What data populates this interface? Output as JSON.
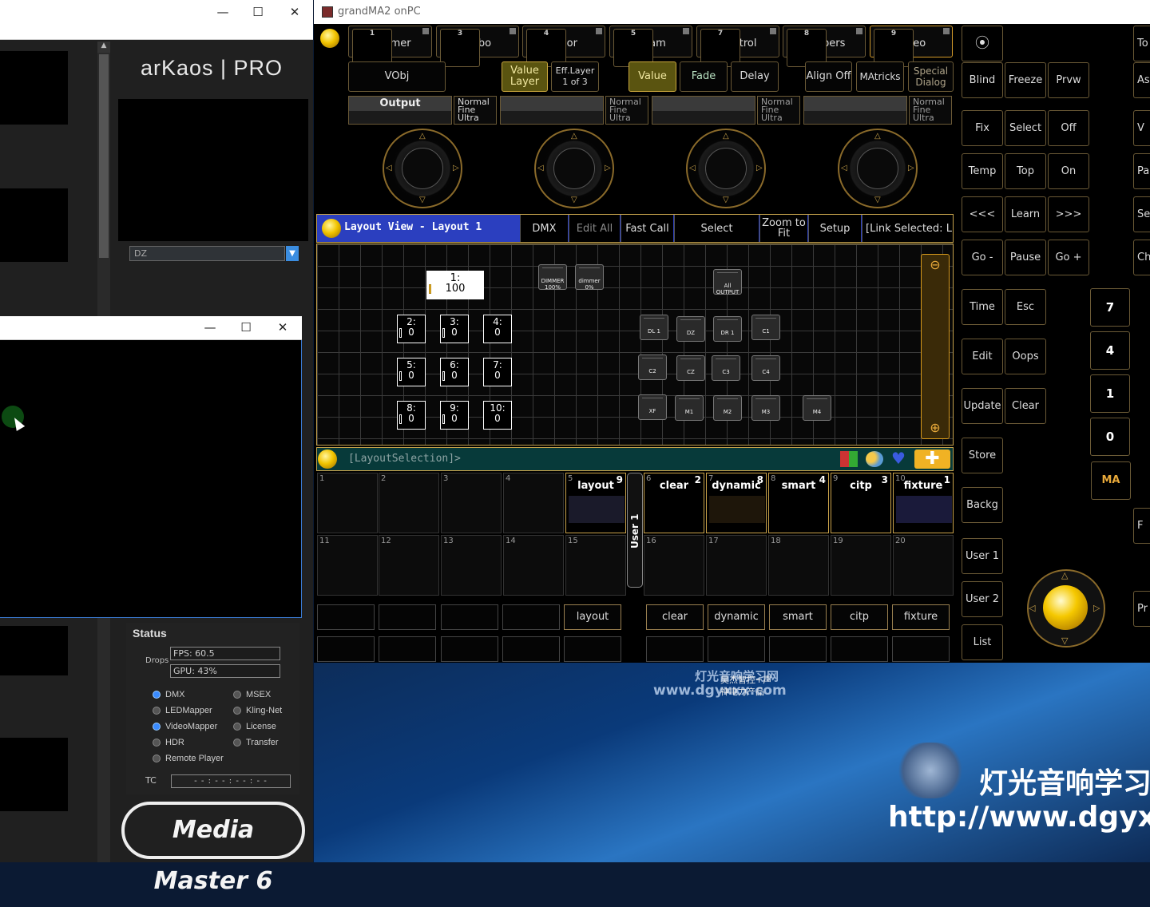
{
  "mediamaster": {
    "logo": "arKaos | PRO",
    "preview_select_value": "DZ",
    "status": {
      "heading": "Status",
      "drops_label": "Drops",
      "fps": "FPS: 60.5",
      "gpu": "GPU: 43%",
      "radios": [
        {
          "label": "DMX",
          "on": true
        },
        {
          "label": "MSEX",
          "on": false
        },
        {
          "label": "LEDMapper",
          "on": false
        },
        {
          "label": "Kling-Net",
          "on": false
        },
        {
          "label": "VideoMapper",
          "on": true
        },
        {
          "label": "License",
          "on": false
        },
        {
          "label": "HDR",
          "on": false
        },
        {
          "label": "Transfer",
          "on": false
        },
        {
          "label": "Remote Player",
          "on": false
        }
      ],
      "tc_label": "TC",
      "tc_value": "- - : - - : - - : - -"
    },
    "brand": "Media Master 6",
    "window_controls": [
      "—",
      "☐",
      "✕"
    ]
  },
  "grandma": {
    "title": "grandMA2 onPC",
    "attributes": [
      {
        "num": "1",
        "label": "Dimmer"
      },
      {
        "num": "3",
        "label": "Gobo"
      },
      {
        "num": "4",
        "label": "Color"
      },
      {
        "num": "5",
        "label": "Beam"
      },
      {
        "num": "7",
        "label": "Control"
      },
      {
        "num": "8",
        "label": "Shapers"
      },
      {
        "num": "9",
        "label": "Video"
      }
    ],
    "encoder_buttons": {
      "vobj": "VObj",
      "value_layer": "Value Layer",
      "eff_layer": "Eff.Layer 1 of 3",
      "value": "Value",
      "fade": "Fade",
      "delay": "Delay",
      "align_off": "Align Off",
      "matricks": "MAtricks",
      "special_dialog": "Special Dialog"
    },
    "encoder_output": "Output",
    "resolution": "Normal Fine Ultra",
    "layout_view": {
      "title": "Layout View - Layout 1",
      "tabs": [
        "DMX",
        "Edit All",
        "Fast Call",
        "Select",
        "Zoom to Fit",
        "Setup",
        "[Link Selected: L"
      ],
      "cells": [
        {
          "id": "1:",
          "val": "100"
        },
        {
          "id": "2:",
          "val": "0"
        },
        {
          "id": "3:",
          "val": "0"
        },
        {
          "id": "4:",
          "val": "0"
        },
        {
          "id": "5:",
          "val": "0"
        },
        {
          "id": "6:",
          "val": "0"
        },
        {
          "id": "7:",
          "val": "0"
        },
        {
          "id": "8:",
          "val": "0"
        },
        {
          "id": "9:",
          "val": "0"
        },
        {
          "id": "10:",
          "val": "0"
        }
      ],
      "fixtures": [
        "DIMMER 100%",
        "dimmer 0%",
        "All OUTPUT",
        "DL 1",
        "DZ",
        "DR 1",
        "C1",
        "C2",
        "CZ",
        "C3",
        "C4",
        "XF",
        "M1",
        "M2",
        "M3",
        "M4"
      ]
    },
    "selection_bar": "[LayoutSelection]>",
    "pool": {
      "side_label": "User 1",
      "row1": [
        {
          "n": "1"
        },
        {
          "n": "2"
        },
        {
          "n": "3"
        },
        {
          "n": "4"
        },
        {
          "n": "5",
          "label": "layout",
          "count": "9"
        },
        {
          "n": "6",
          "label": "clear",
          "count": "2"
        },
        {
          "n": "7",
          "label": "dynamic",
          "count": "8"
        },
        {
          "n": "8",
          "label": "smart",
          "count": "4"
        },
        {
          "n": "9",
          "label": "citp",
          "count": "3"
        },
        {
          "n": "10",
          "label": "fixture",
          "count": "1"
        }
      ],
      "row2": [
        "11",
        "12",
        "13",
        "14",
        "15",
        "16",
        "17",
        "18",
        "19",
        "20"
      ]
    },
    "executors": [
      "layout",
      "clear",
      "dynamic",
      "smart",
      "citp",
      "fixture"
    ],
    "keys": {
      "col1": [
        "Blind",
        "Fix",
        "Temp",
        "<<<",
        "Go -",
        "Time",
        "Edit",
        "Update",
        "Store",
        "Backg",
        "User 1",
        "User 2",
        "List"
      ],
      "col2": [
        "Freeze",
        "Select",
        "Top",
        "Learn",
        "Pause",
        "Esc",
        "Oops",
        "Clear"
      ],
      "col3": [
        "Prvw",
        "Off",
        "On",
        ">>>",
        "Go +"
      ],
      "numpad": [
        "7",
        "4",
        "1",
        "0"
      ],
      "ma_logo": "MA",
      "edge": [
        "To",
        "As",
        "V",
        "Pa",
        "Se",
        "Ch",
        "F",
        "Pr"
      ]
    }
  },
  "watermark": {
    "cn_site": "灯光音响学习网",
    "url_small": "www.dgyxxx.com",
    "overlay": "昊杰智控+声\n神电力产品",
    "brand_cn": "灯光音响学习",
    "url_big": "http://www.dgyx"
  },
  "colors": {
    "accent": "#c9a24a",
    "layout_bar": "#2b3fbf",
    "selection_bar": "#073a3a",
    "ball": "#f2c400"
  }
}
